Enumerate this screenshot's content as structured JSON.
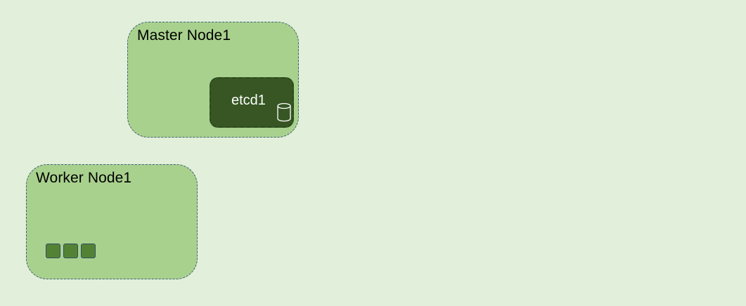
{
  "colors": {
    "background": "#e2efda",
    "node_fill": "#a9d18e",
    "node_border": "#41607a",
    "etcd_fill": "#375623",
    "pod_fill": "#548235",
    "etcd_text": "#ffffff"
  },
  "master_node": {
    "label": "Master Node1",
    "etcd": {
      "label": "etcd1",
      "icon": "database-icon"
    }
  },
  "worker_node": {
    "label": "Worker Node1",
    "pods": [
      {
        "icon": "pod-square"
      },
      {
        "icon": "pod-square"
      },
      {
        "icon": "pod-square"
      }
    ]
  }
}
